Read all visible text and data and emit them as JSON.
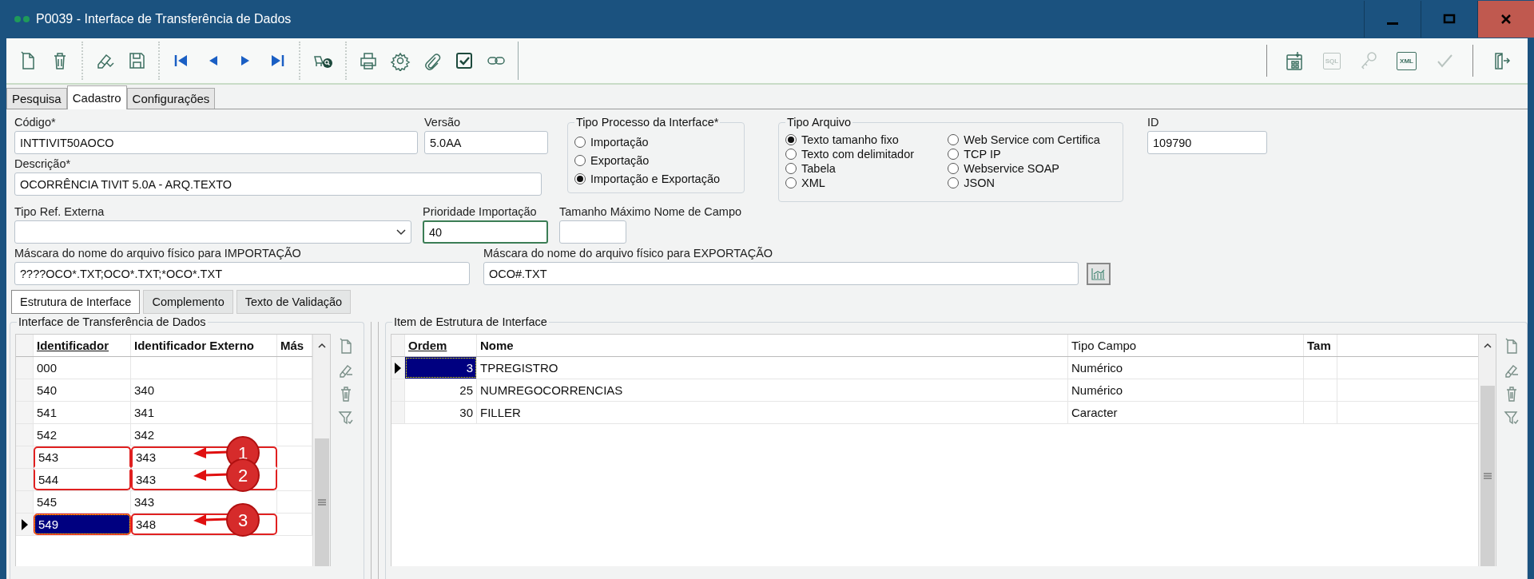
{
  "window": {
    "title": "P0039 - Interface de Transferência de Dados"
  },
  "toolbar": {
    "left_groups": [
      [
        {
          "kind": "new"
        },
        {
          "kind": "delete"
        }
      ],
      [
        {
          "kind": "edit"
        },
        {
          "kind": "save"
        }
      ],
      [
        {
          "kind": "first"
        },
        {
          "kind": "prev"
        },
        {
          "kind": "next"
        },
        {
          "kind": "last"
        }
      ],
      [
        {
          "kind": "find"
        }
      ],
      [
        {
          "kind": "print"
        },
        {
          "kind": "settings"
        },
        {
          "kind": "attach"
        },
        {
          "kind": "check"
        },
        {
          "kind": "link"
        }
      ]
    ],
    "right": [
      {
        "kind": "spreadsheet",
        "disabled": false
      },
      {
        "kind": "sql",
        "label": "SQL",
        "disabled": true
      },
      {
        "kind": "key",
        "disabled": true
      },
      {
        "kind": "xml",
        "label": "XML",
        "disabled": false
      },
      {
        "kind": "confirm",
        "disabled": true
      },
      {
        "kind": "exit",
        "disabled": false
      }
    ]
  },
  "tabs": [
    {
      "label": "Pesquisa",
      "selected": false
    },
    {
      "label": "Cadastro",
      "selected": true
    },
    {
      "label": "Configurações",
      "selected": false
    }
  ],
  "form": {
    "codigo": {
      "label": "Código*",
      "value": "INTTIVIT50AOCO"
    },
    "versao": {
      "label": "Versão",
      "value": "5.0AA"
    },
    "descricao": {
      "label": "Descrição*",
      "value": "OCORRÊNCIA TIVIT 5.0A - ARQ.TEXTO"
    },
    "tipo_processo": {
      "title": "Tipo Processo da Interface*",
      "options": [
        {
          "label": "Importação",
          "selected": false
        },
        {
          "label": "Exportação",
          "selected": false
        },
        {
          "label": "Importação e Exportação",
          "selected": true
        }
      ]
    },
    "tipo_arquivo": {
      "title": "Tipo Arquivo",
      "options": [
        {
          "label": "Texto tamanho fixo",
          "selected": true
        },
        {
          "label": "Texto com delimitador",
          "selected": false
        },
        {
          "label": "Tabela",
          "selected": false
        },
        {
          "label": "XML",
          "selected": false
        },
        {
          "label": "Web Service com Certifica",
          "selected": false
        },
        {
          "label": "TCP IP",
          "selected": false
        },
        {
          "label": "Webservice SOAP",
          "selected": false
        },
        {
          "label": "JSON",
          "selected": false
        }
      ]
    },
    "id": {
      "label": "ID",
      "value": "109790"
    },
    "tipo_ref_externa": {
      "label": "Tipo Ref. Externa"
    },
    "prioridade_importacao": {
      "label": "Prioridade Importação",
      "value": "40",
      "focused": true
    },
    "tamanho_maximo": {
      "label": "Tamanho Máximo Nome de Campo"
    },
    "mascara_importacao": {
      "label": "Máscara do nome do arquivo físico para IMPORTAÇÃO",
      "value": "????OCO*.TXT;OCO*.TXT;*OCO*.TXT"
    },
    "mascara_exportacao": {
      "label": "Máscara do nome do arquivo físico para EXPORTAÇÃO",
      "value": "OCO#.TXT"
    }
  },
  "subtabs": [
    {
      "label": "Estrutura de Interface",
      "selected": true
    },
    {
      "label": "Complemento",
      "selected": false
    },
    {
      "label": "Texto de Validação",
      "selected": false
    }
  ],
  "left_panel": {
    "title": "Interface de Transferência de Dados",
    "columns": [
      {
        "label": "Identificador",
        "sorted": true,
        "bold": true
      },
      {
        "label": "Identificador Externo",
        "sorted": false,
        "bold": true
      },
      {
        "label": "Más",
        "sorted": false,
        "bold": true
      }
    ],
    "rows": [
      {
        "selected": false,
        "cells": [
          {
            "text": "000",
            "outlined": false
          }
        ]
      },
      {
        "selected": false,
        "cells": [
          {
            "text": "540",
            "outlined": false
          },
          {
            "text": "340",
            "outlined": false
          }
        ]
      },
      {
        "selected": false,
        "cells": [
          {
            "text": "541",
            "outlined": false
          },
          {
            "text": "341",
            "outlined": false
          }
        ]
      },
      {
        "selected": false,
        "cells": [
          {
            "text": "542",
            "outlined": false
          },
          {
            "text": "342",
            "outlined": false
          }
        ]
      },
      {
        "selected": false,
        "callout": "1",
        "cells": [
          {
            "text": "543",
            "outlined": true
          },
          {
            "text": "343",
            "outlined": true
          }
        ]
      },
      {
        "selected": false,
        "callout": "2",
        "cells": [
          {
            "text": "544",
            "outlined": true
          },
          {
            "text": "343",
            "outlined": true
          }
        ]
      },
      {
        "selected": false,
        "cells": [
          {
            "text": "545",
            "outlined": false
          },
          {
            "text": "343",
            "outlined": false
          }
        ]
      },
      {
        "selected": true,
        "callout": "3",
        "cells": [
          {
            "text": "549",
            "outlined": true
          },
          {
            "text": "348",
            "outlined": true
          }
        ]
      }
    ]
  },
  "right_panel": {
    "title": "Item de Estrutura de Interface",
    "columns": [
      {
        "label": "Ordem",
        "sorted": true,
        "bold": true
      },
      {
        "label": "Nome",
        "sorted": false,
        "bold": true
      },
      {
        "label": "Tipo Campo",
        "sorted": false,
        "bold": false
      },
      {
        "label": "Tam",
        "sorted": false,
        "bold": true
      }
    ],
    "rows": [
      {
        "selected": true,
        "cells": [
          {
            "text": "3"
          },
          {
            "text": "TPREGISTRO"
          },
          {
            "text": "Numérico"
          }
        ]
      },
      {
        "selected": false,
        "cells": [
          {
            "text": "25"
          },
          {
            "text": "NUMREGOCORRENCIAS"
          },
          {
            "text": "Numérico"
          }
        ]
      },
      {
        "selected": false,
        "cells": [
          {
            "text": "30"
          },
          {
            "text": "FILLER"
          },
          {
            "text": "Caracter"
          }
        ]
      }
    ]
  }
}
